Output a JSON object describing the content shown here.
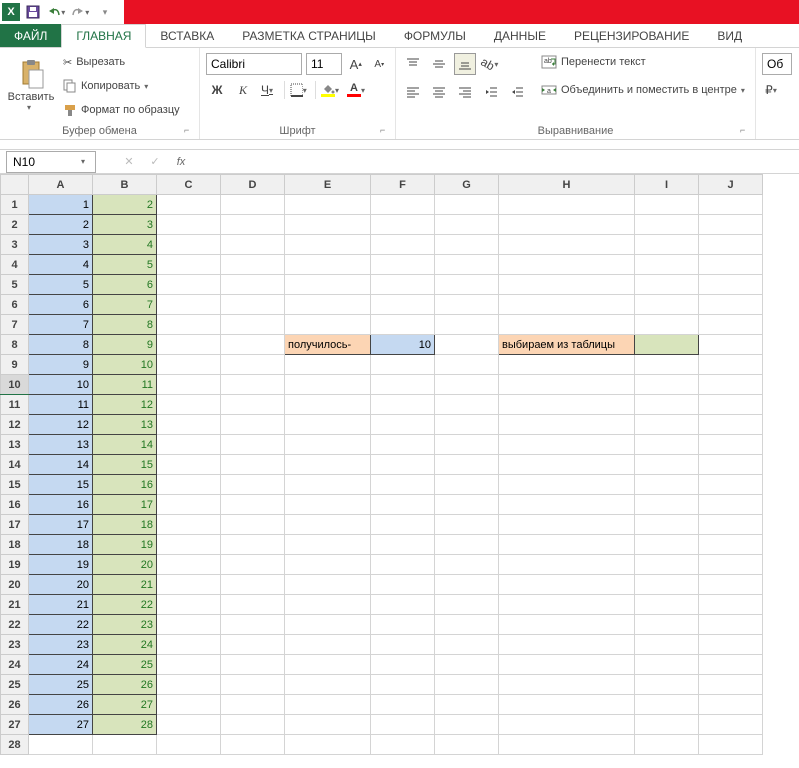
{
  "tabs": {
    "file": "ФАЙЛ",
    "home": "ГЛАВНАЯ",
    "insert": "ВСТАВКА",
    "layout": "РАЗМЕТКА СТРАНИЦЫ",
    "formulas": "ФОРМУЛЫ",
    "data": "ДАННЫЕ",
    "review": "РЕЦЕНЗИРОВАНИЕ",
    "view": "ВИД"
  },
  "ribbon": {
    "paste": "Вставить",
    "cut": "Вырезать",
    "copy": "Копировать",
    "format_painter": "Формат по образцу",
    "clipboard_label": "Буфер обмена",
    "font_name": "Calibri",
    "font_size": "11",
    "font_label": "Шрифт",
    "bold": "Ж",
    "italic": "К",
    "underline": "Ч",
    "wrap_text": "Перенести текст",
    "merge": "Объединить и поместить в центре",
    "alignment_label": "Выравнивание",
    "general": "Об"
  },
  "formula_bar": {
    "name_box": "N10",
    "fx": "fx"
  },
  "grid": {
    "columns": [
      "A",
      "B",
      "C",
      "D",
      "E",
      "F",
      "G",
      "H",
      "I",
      "J"
    ],
    "row_count": 28,
    "selected_row": 10,
    "col_a": [
      1,
      2,
      3,
      4,
      5,
      6,
      7,
      8,
      9,
      10,
      11,
      12,
      13,
      14,
      15,
      16,
      17,
      18,
      19,
      20,
      21,
      22,
      23,
      24,
      25,
      26,
      27
    ],
    "col_b": [
      2,
      3,
      4,
      5,
      6,
      7,
      8,
      9,
      10,
      11,
      12,
      13,
      14,
      15,
      16,
      17,
      18,
      19,
      20,
      21,
      22,
      23,
      24,
      25,
      26,
      27,
      28
    ],
    "e8": "получилось-",
    "f8": "10",
    "h8": "выбираем из таблицы"
  }
}
